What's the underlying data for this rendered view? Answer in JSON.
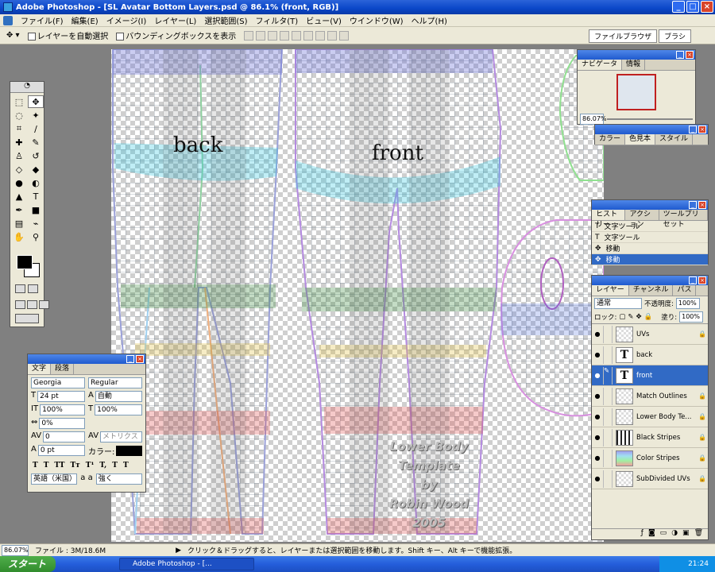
{
  "window": {
    "title": "Adobe Photoshop - [SL Avatar Bottom Layers.psd @ 86.1% (front, RGB)]"
  },
  "menu": [
    "ファイル(F)",
    "編集(E)",
    "イメージ(I)",
    "レイヤー(L)",
    "選択範囲(S)",
    "フィルタ(T)",
    "ビュー(V)",
    "ウインドウ(W)",
    "ヘルプ(H)"
  ],
  "options": {
    "auto_select": "レイヤーを自動選択",
    "bounding_box": "バウンディングボックスを表示"
  },
  "palette_well": [
    "ファイルブラウザ",
    "ブラシ"
  ],
  "canvas": {
    "label_back": "back",
    "label_front": "front",
    "credit": [
      "Lower Body",
      "Template",
      "by",
      "Robin Wood",
      "2005"
    ]
  },
  "navigator": {
    "tabs": [
      "ナビゲータ",
      "情報"
    ],
    "zoom": "86.07%"
  },
  "color_panel": {
    "tabs": [
      "カラー",
      "色見本",
      "スタイル"
    ]
  },
  "history": {
    "tabs": [
      "ヒストリー",
      "アクション",
      "ツールプリセット"
    ],
    "items": [
      {
        "label": "文字ツール",
        "icon": "T"
      },
      {
        "label": "文字ツール",
        "icon": "T"
      },
      {
        "label": "移動",
        "icon": "✥"
      },
      {
        "label": "移動",
        "icon": "✥"
      }
    ]
  },
  "character": {
    "tabs": [
      "文字",
      "段落"
    ],
    "font": "Georgia",
    "style": "Regular",
    "size": "24 pt",
    "leading": "自動",
    "vscale": "100%",
    "hscale": "100%",
    "tracking": "0%",
    "kerning": "0",
    "kern_mode": "メトリクス",
    "baseline": "0 pt",
    "color_label": "カラー:",
    "language": "英語（米国）",
    "aa_label": "a a",
    "antialias": "強く",
    "style_buttons": [
      "T",
      "T",
      "TT",
      "Tт",
      "T¹",
      "T,",
      "T",
      "T"
    ]
  },
  "layers": {
    "tabs": [
      "レイヤー",
      "チャンネル",
      "パス"
    ],
    "blend": "通常",
    "opacity_label": "不透明度:",
    "opacity": "100%",
    "lock_label": "ロック:",
    "fill_label": "塗り:",
    "fill": "100%",
    "items": [
      {
        "name": "UVs",
        "kind": "img"
      },
      {
        "name": "back",
        "kind": "text"
      },
      {
        "name": "front",
        "kind": "text",
        "selected": true
      },
      {
        "name": "Match Outlines",
        "kind": "img"
      },
      {
        "name": "Lower Body Te...",
        "kind": "img"
      },
      {
        "name": "Black Stripes",
        "kind": "img"
      },
      {
        "name": "Color Stripes",
        "kind": "img"
      },
      {
        "name": "SubDivided UVs",
        "kind": "img"
      }
    ]
  },
  "status": {
    "zoom": "86.07%",
    "file": "ファイル : 3M/18.6M",
    "hint": "クリック＆ドラッグすると、レイヤーまたは選択範囲を移動します。Shift キー、Alt キーで機能拡張。"
  },
  "taskbar": {
    "start": "スタート",
    "task": "Adobe Photoshop - [...",
    "clock": "21:24"
  },
  "colors": {
    "accent": "#316ac5",
    "titlebar": "#0a46c8"
  }
}
